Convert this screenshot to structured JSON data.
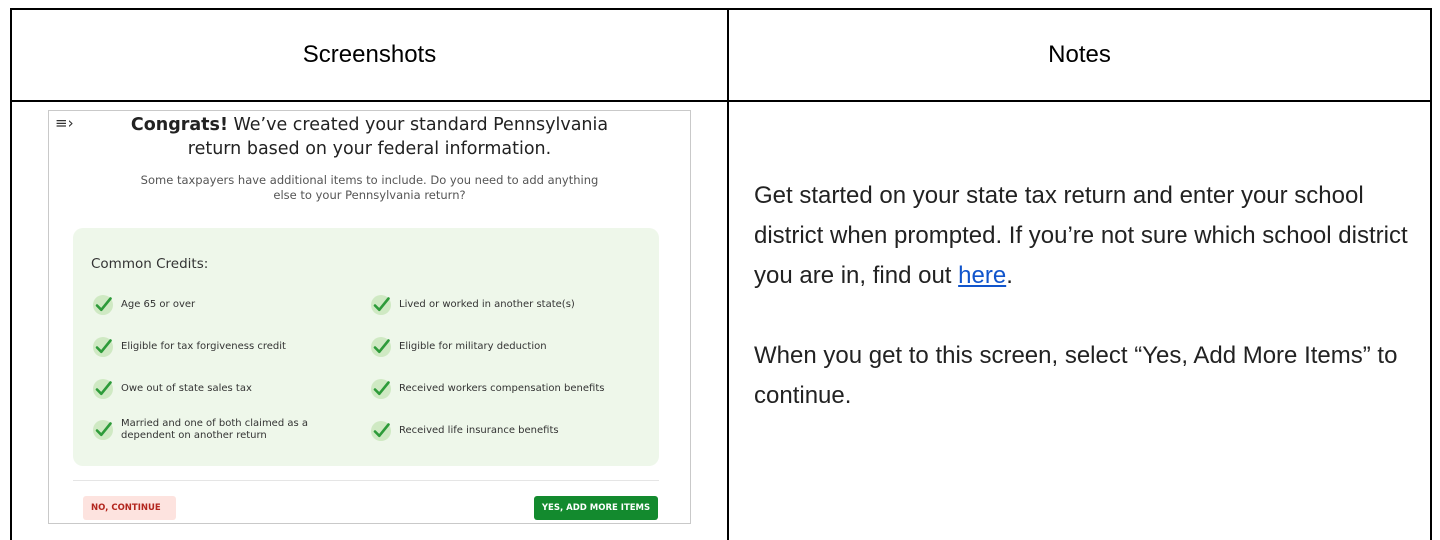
{
  "table": {
    "header_left": "Screenshots",
    "header_right": "Notes"
  },
  "screenshot": {
    "menu_icon": "≡›",
    "title_bold": "Congrats!",
    "title_line1_rest": " We’ve created your standard Pennsylvania",
    "title_line2": "return based on your federal information.",
    "subtitle_line1": "Some taxpayers have additional items to include. Do you need to add anything",
    "subtitle_line2": "else to your Pennsylvania return?",
    "panel_title": "Common Credits:",
    "items": [
      "Age 65 or over",
      "Lived or worked in another state(s)",
      "Eligible for tax forgiveness credit",
      "Eligible for military deduction",
      "Owe out of state sales tax",
      "Received workers compensation benefits",
      "Married and one of both claimed as a dependent on another return",
      "Received life insurance benefits"
    ],
    "btn_no": "NO, CONTINUE",
    "btn_yes": "YES, ADD MORE ITEMS"
  },
  "notes": {
    "para1_before_link": "Get started on your state tax return and enter your school district when prompted.  If you’re not sure which school district you are in, find out ",
    "link_text": "here",
    "para1_after_link": ".",
    "para2": "When you get to this screen, select “Yes, Add More Items” to continue."
  },
  "colors": {
    "panel_bg": "#eef7ea",
    "check_green": "#2e9b3a",
    "yes_button": "#138a2e",
    "no_button_bg": "#fde3df",
    "no_button_text": "#b3261e",
    "link": "#1155cc"
  }
}
